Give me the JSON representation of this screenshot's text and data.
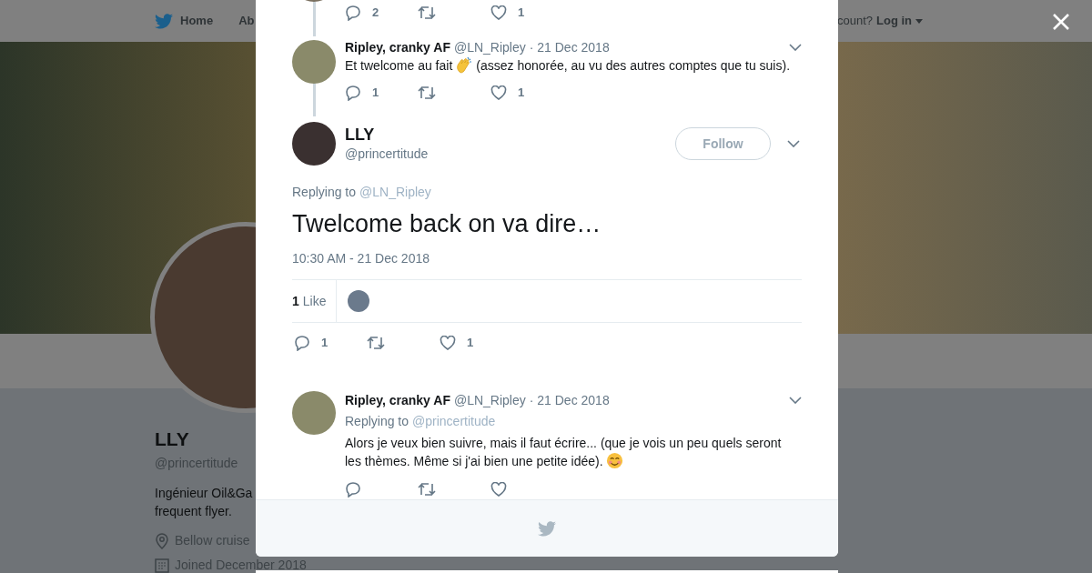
{
  "background_page": {
    "nav": [
      {
        "label": "Home"
      },
      {
        "label": "Ab"
      }
    ],
    "login_prompt": "count?",
    "login": "Log in",
    "profile": {
      "name": "LLY",
      "handle": "@princertitude",
      "bio_lines": [
        "Ingénieur Oil&Ga",
        "frequent flyer."
      ],
      "location": "Bellow cruise",
      "joined": "Joined December 2018"
    }
  },
  "modal": {
    "parent_tweet": {
      "actions": [
        {
          "kind": "reply",
          "count": "2"
        },
        {
          "kind": "retweet"
        },
        {
          "kind": "like",
          "count": "1"
        }
      ]
    },
    "thread_reply": {
      "name": "Ripley, cranky AF",
      "handle": "@LN_Ripley",
      "date": "· 21 Dec 2018",
      "text_parts": [
        {
          "kind": "text",
          "text": "Et twelcome au fait"
        },
        {
          "kind": "clap"
        },
        {
          "kind": "text",
          "text": "(assez honorée, au vu des autres comptes que tu suis)."
        }
      ],
      "actions": [
        {
          "kind": "reply",
          "count": "1"
        },
        {
          "kind": "retweet"
        },
        {
          "kind": "like",
          "count": "1"
        }
      ]
    },
    "main_tweet": {
      "name": "LLY",
      "handle": "@princertitude",
      "follow": "Follow",
      "replying_label": "Replying to",
      "replying_to": "@LN_Ripley",
      "text": "Twelcome back on va dire…",
      "time": "10:30 AM - 21 Dec 2018",
      "likes_count": "1",
      "likes_label": "Like",
      "actions": [
        {
          "kind": "reply",
          "count": "1"
        },
        {
          "kind": "retweet"
        },
        {
          "kind": "like",
          "count": "1"
        }
      ]
    },
    "replies": [
      {
        "name": "Ripley, cranky AF",
        "handle": "@LN_Ripley",
        "date": "· 21 Dec 2018",
        "replying_label": "Replying to",
        "replying_to": "@princertitude",
        "text_parts": [
          {
            "kind": "text",
            "text": "Alors je veux bien suivre, mais il faut écrire... (que je vois un peu quels seront"
          },
          {
            "kind": "text",
            "text": "les thèmes. Même si j'ai bien une petite idée)."
          },
          {
            "kind": "smile"
          }
        ],
        "actions": [
          {
            "kind": "reply"
          },
          {
            "kind": "retweet"
          },
          {
            "kind": "like"
          }
        ]
      }
    ]
  }
}
